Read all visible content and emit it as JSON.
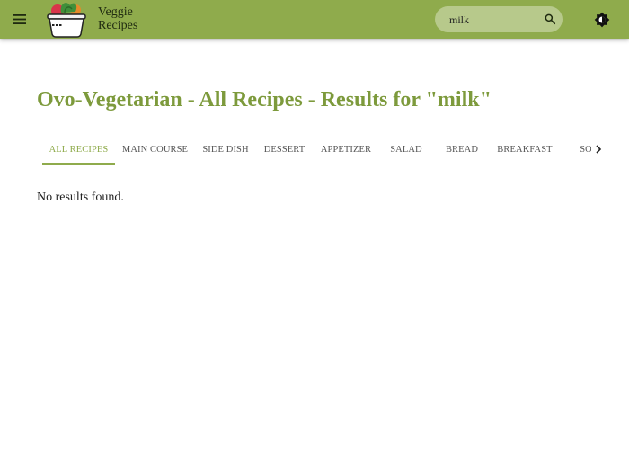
{
  "header": {
    "brand_line1": "Veggie",
    "brand_line2": "Recipes",
    "search_value": "milk",
    "accent": "#8fab4c"
  },
  "page": {
    "title": "Ovo-Vegetarian - All Recipes - Results for \"milk\"",
    "message": "No results found."
  },
  "tabs": [
    {
      "label": "ALL RECIPES",
      "active": true
    },
    {
      "label": "MAIN COURSE"
    },
    {
      "label": "SIDE DISH"
    },
    {
      "label": "DESSERT"
    },
    {
      "label": "APPETIZER"
    },
    {
      "label": "SALAD"
    },
    {
      "label": "BREAD"
    },
    {
      "label": "BREAKFAST"
    },
    {
      "label": "SO"
    }
  ],
  "icons": {
    "menu": "menu-icon",
    "search": "search-icon",
    "theme": "brightness-icon",
    "scroll": "chevron-right-icon",
    "logo": "veggie-bowl-logo"
  }
}
